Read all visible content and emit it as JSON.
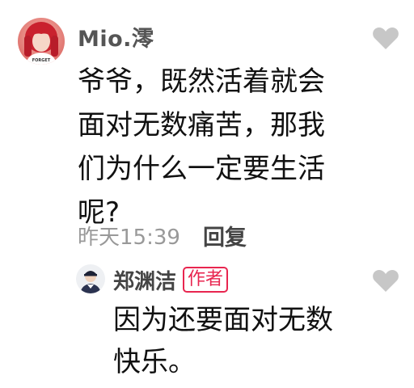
{
  "comment": {
    "username": "Mio.澪",
    "text": "爷爷，既然活着就会面对无数痛苦，那我们为什么一定要生活呢?",
    "timestamp": "昨天15:39",
    "reply_label": "回复",
    "avatar_shirt_text": "FORGET"
  },
  "reply": {
    "username": "郑渊洁",
    "badge": "作者",
    "text": "因为还要面对无数快乐。"
  },
  "icons": {
    "like": "heart-icon",
    "avatar": "avatar-icon"
  },
  "colors": {
    "badge": "#e8254f",
    "heart": "#c7c7c7",
    "timestamp": "#999999"
  }
}
